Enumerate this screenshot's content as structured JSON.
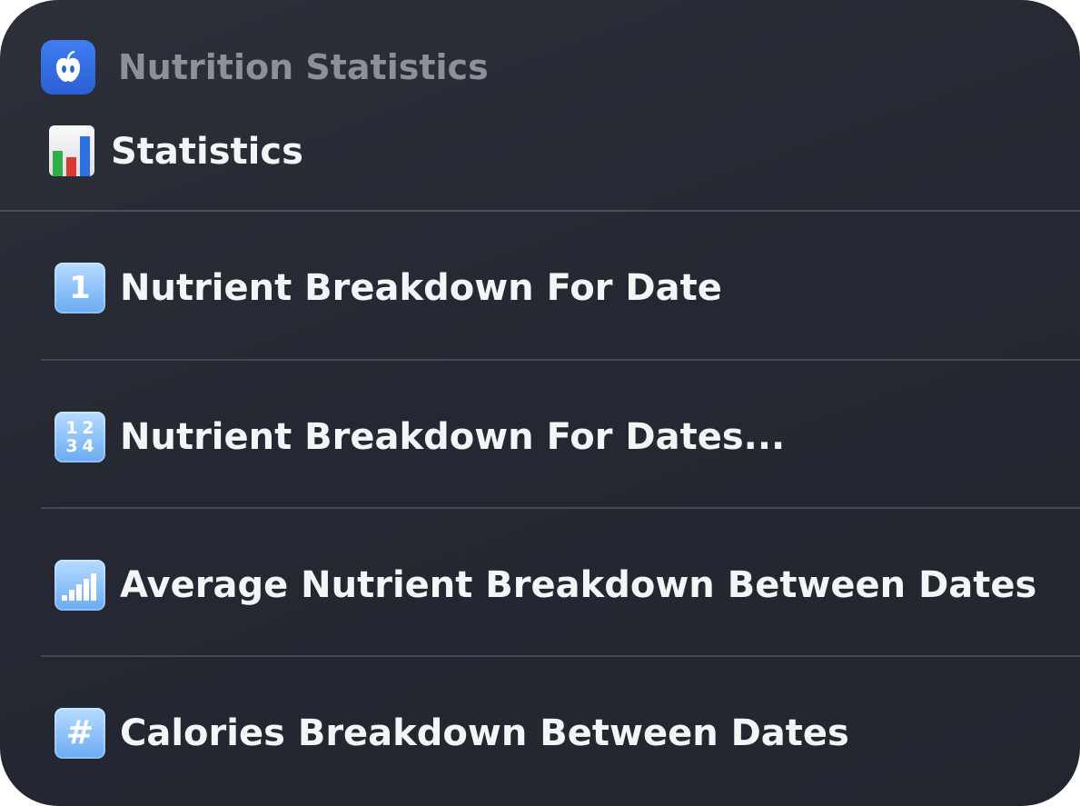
{
  "header": {
    "app_name": "Nutrition Statistics",
    "app_icon": "apple-icon",
    "accent_color": "#3a74e8"
  },
  "section": {
    "title": "Statistics",
    "icon": "bar-chart-icon"
  },
  "items": [
    {
      "label": "Nutrient Breakdown For Date",
      "icon": "keycap-one-icon",
      "icon_glyph": "1"
    },
    {
      "label": "Nutrient Breakdown For Dates...",
      "icon": "input-numbers-icon",
      "icon_glyphs": [
        "1",
        "2",
        "3",
        "4"
      ]
    },
    {
      "label": "Average Nutrient Breakdown Between Dates",
      "icon": "signal-bars-icon"
    },
    {
      "label": "Calories Breakdown Between Dates",
      "icon": "keycap-hash-icon",
      "icon_glyph": "#"
    }
  ]
}
